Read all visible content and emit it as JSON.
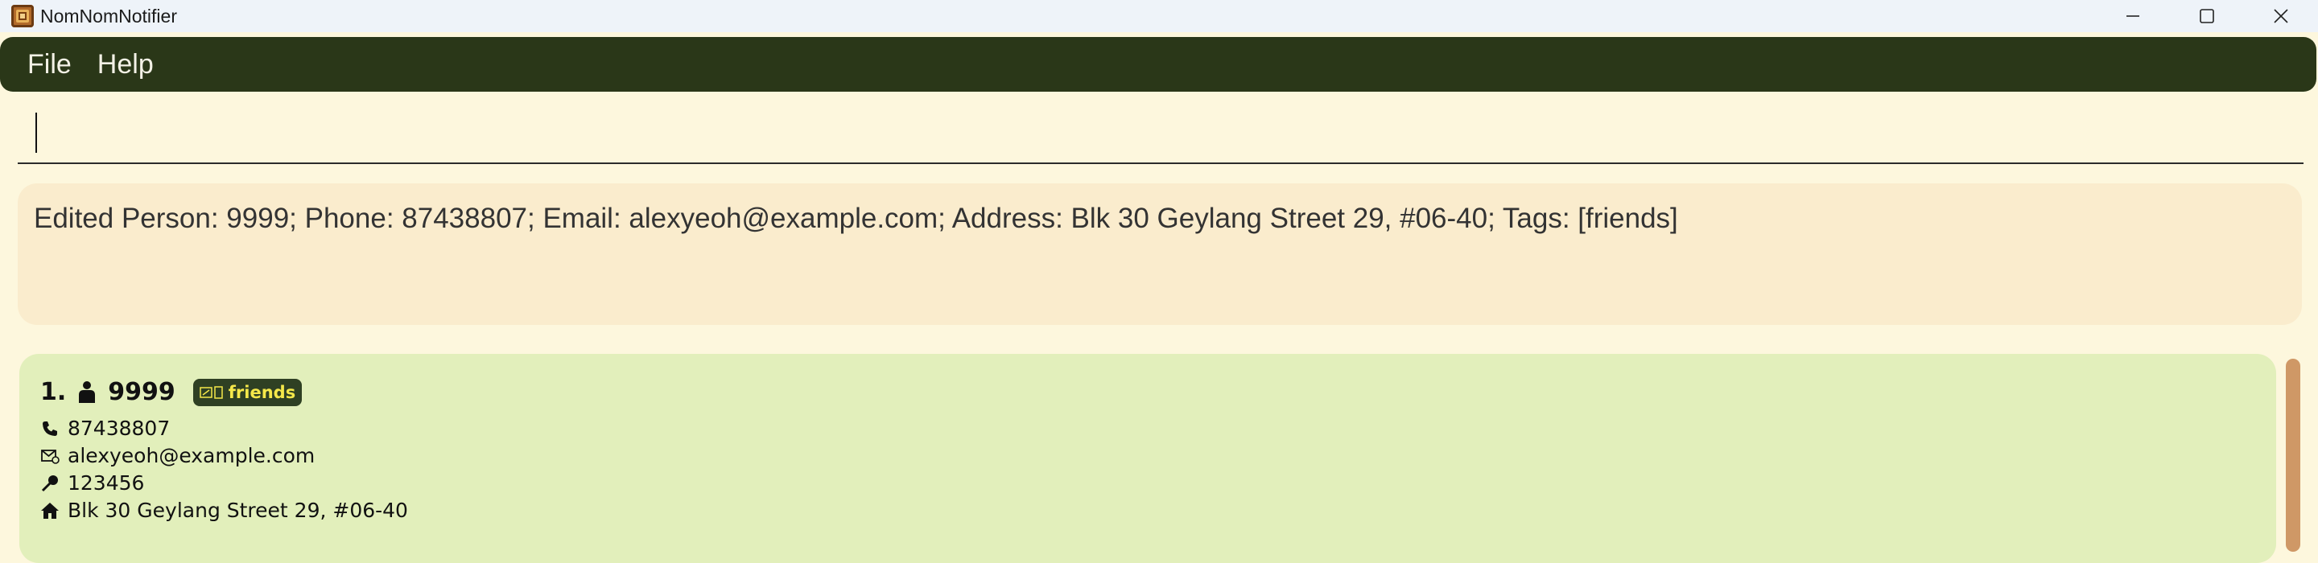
{
  "window": {
    "title": "NomNomNotifier"
  },
  "menu": {
    "items": [
      "File",
      "Help"
    ]
  },
  "command": {
    "value": ""
  },
  "result": {
    "text": "Edited Person: 9999; Phone: 87438807; Email: alexyeoh@example.com; Address: Blk 30 Geylang Street 29, #06-40; Tags: [friends]"
  },
  "persons": [
    {
      "index": "1.",
      "name": "9999",
      "tags": [
        "friends"
      ],
      "phone": "87438807",
      "email": "alexyeoh@example.com",
      "postal": "123456",
      "address": "Blk 30 Geylang Street 29, #06-40"
    }
  ],
  "colors": {
    "menubar": "#2a3718",
    "background": "#fdf7dd",
    "result_bg": "#faeccd",
    "card_bg": "#e2efbb",
    "tag_bg": "#2f4023",
    "tag_text": "#f5e84a",
    "scrollbar": "#cf9866"
  },
  "icons": {
    "app": "app-logo-icon",
    "minimize": "minimize-icon",
    "maximize": "maximize-icon",
    "close": "close-icon",
    "person": "person-icon",
    "tag": "tag-icon",
    "phone": "phone-icon",
    "email": "email-icon",
    "pin": "pin-icon",
    "address": "home-icon"
  }
}
